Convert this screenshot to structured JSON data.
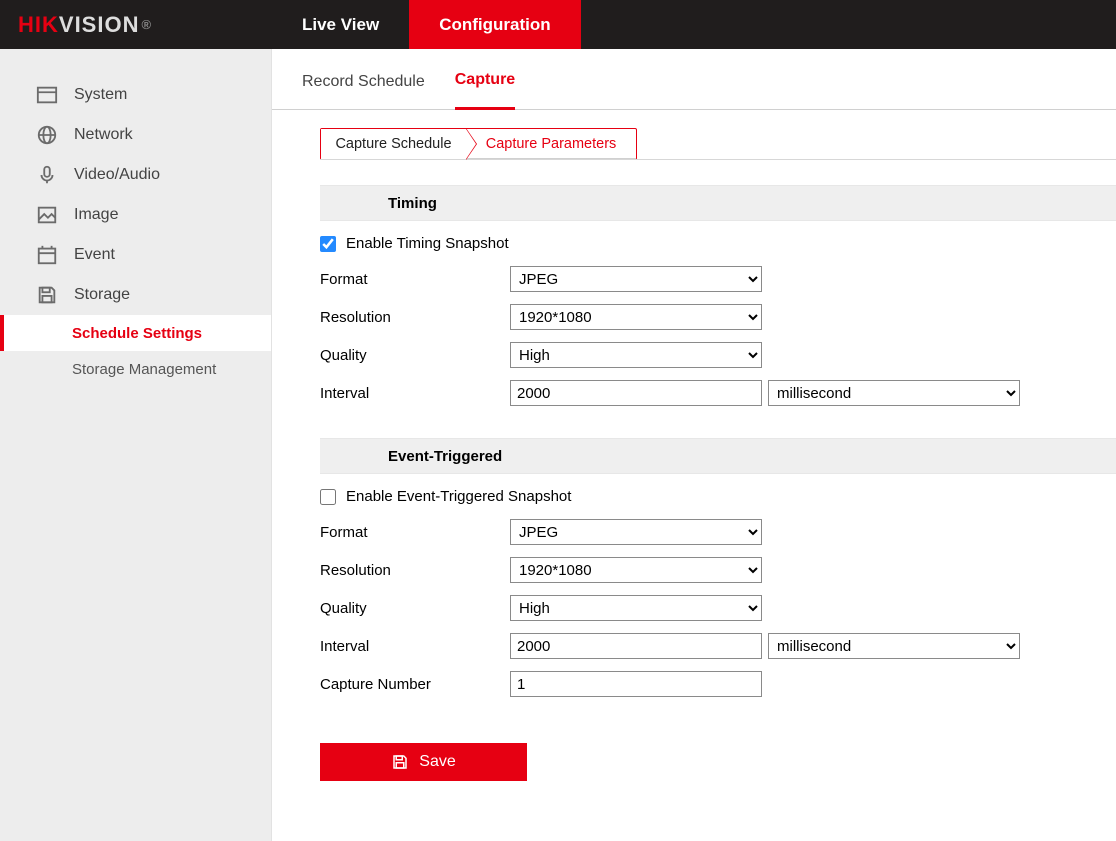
{
  "brand": {
    "part1": "HIK",
    "part2": "VISION",
    "reg": "®"
  },
  "topTabs": {
    "live": "Live View",
    "config": "Configuration"
  },
  "sidebar": {
    "system": "System",
    "network": "Network",
    "video": "Video/Audio",
    "image": "Image",
    "event": "Event",
    "storage": "Storage",
    "schedule": "Schedule Settings",
    "storagemgmt": "Storage Management"
  },
  "innerTabs": {
    "record": "Record Schedule",
    "capture": "Capture"
  },
  "crumbs": {
    "schedule": "Capture Schedule",
    "params": "Capture Parameters"
  },
  "timing": {
    "header": "Timing",
    "enable": "Enable Timing Snapshot",
    "formatLabel": "Format",
    "formatValue": "JPEG",
    "resLabel": "Resolution",
    "resValue": "1920*1080",
    "qualityLabel": "Quality",
    "qualityValue": "High",
    "intervalLabel": "Interval",
    "intervalValue": "2000",
    "intervalUnit": "millisecond"
  },
  "event": {
    "header": "Event-Triggered",
    "enable": "Enable Event-Triggered Snapshot",
    "formatLabel": "Format",
    "formatValue": "JPEG",
    "resLabel": "Resolution",
    "resValue": "1920*1080",
    "qualityLabel": "Quality",
    "qualityValue": "High",
    "intervalLabel": "Interval",
    "intervalValue": "2000",
    "intervalUnit": "millisecond",
    "capNumLabel": "Capture Number",
    "capNumValue": "1"
  },
  "save": "Save"
}
